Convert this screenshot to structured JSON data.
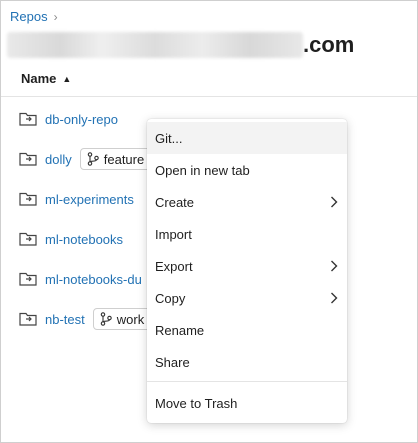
{
  "breadcrumb": {
    "root_label": "Repos",
    "separator": "›"
  },
  "page_title": {
    "suffix": ".com"
  },
  "table": {
    "name_header": "Name",
    "rows": [
      {
        "name": "db-only-repo",
        "branch": ""
      },
      {
        "name": "dolly",
        "branch": "feature"
      },
      {
        "name": "ml-experiments",
        "branch": ""
      },
      {
        "name": "ml-notebooks",
        "branch": ""
      },
      {
        "name": "ml-notebooks-du",
        "branch": ""
      },
      {
        "name": "nb-test",
        "branch": "work"
      }
    ]
  },
  "context_menu": {
    "items": [
      {
        "label": "Git...",
        "submenu": false
      },
      {
        "label": "Open in new tab",
        "submenu": false
      },
      {
        "label": "Create",
        "submenu": true
      },
      {
        "label": "Import",
        "submenu": false
      },
      {
        "label": "Export",
        "submenu": true
      },
      {
        "label": "Copy",
        "submenu": true
      },
      {
        "label": "Rename",
        "submenu": false
      },
      {
        "label": "Share",
        "submenu": false
      },
      {
        "label": "Move to Trash",
        "submenu": false
      }
    ]
  },
  "colors": {
    "link": "#2272b4",
    "text": "#1f1f1f",
    "border": "#cfcfcf"
  },
  "icons": {
    "repo": "repo-folder-icon",
    "branch": "git-branch-icon",
    "sort": "sort-ascending-icon",
    "submenu": "chevron-right-icon"
  }
}
